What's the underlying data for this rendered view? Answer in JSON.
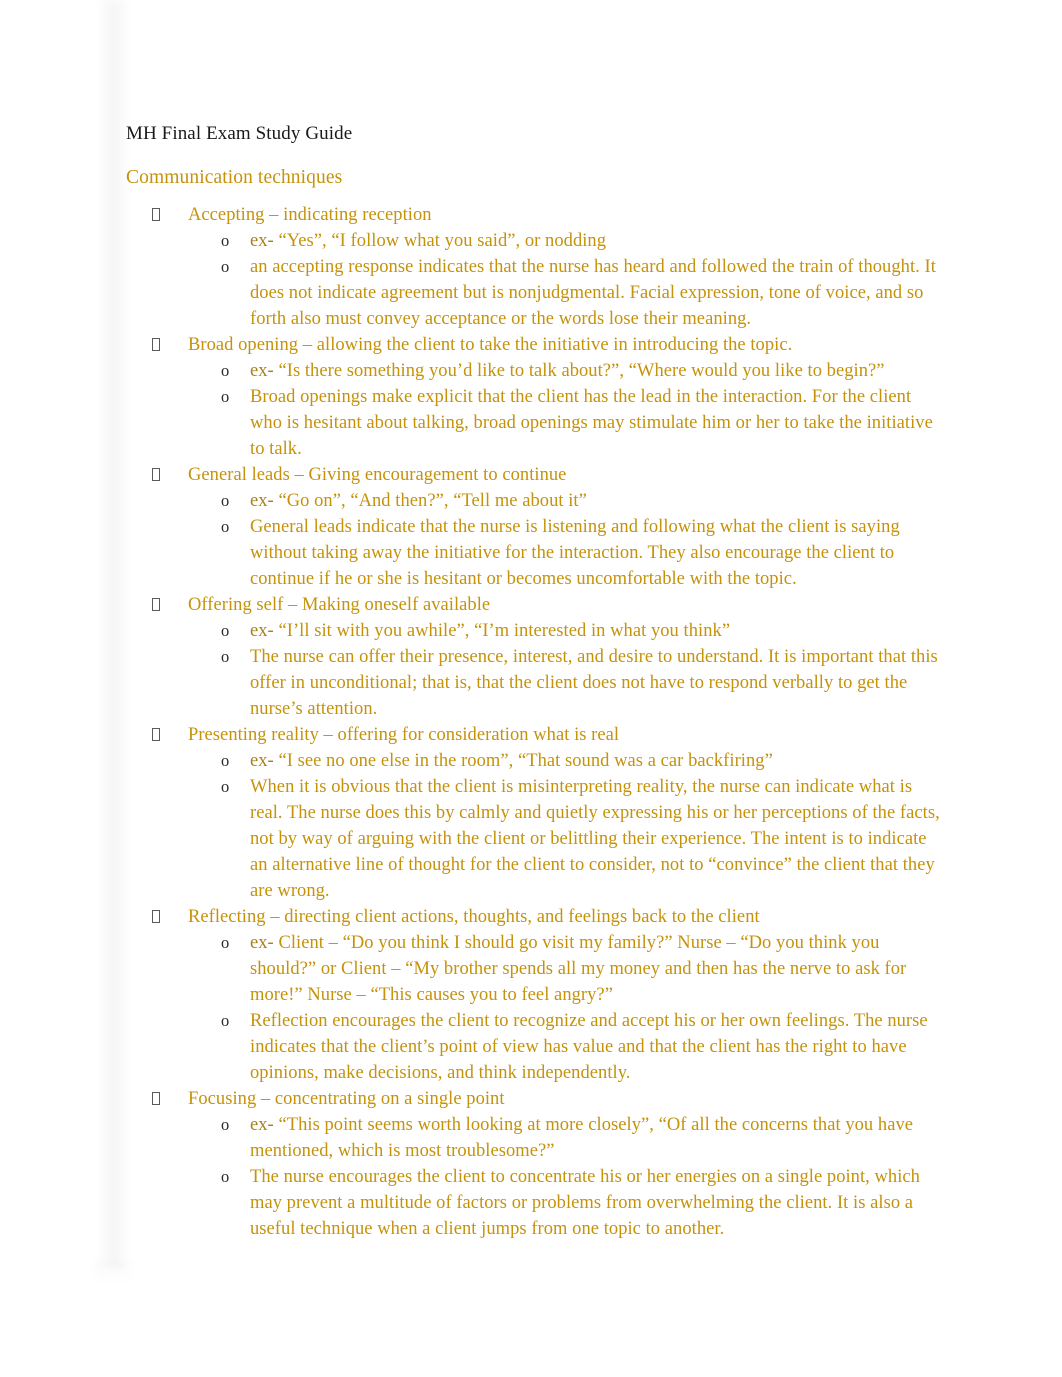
{
  "document": {
    "title": "MH Final Exam Study Guide",
    "section_heading": "Communication techniques",
    "colors": {
      "title_text": "#1a1a1a",
      "body_text": "#c59209",
      "marker_text": "#2b2b2b",
      "page_background": "#ffffff"
    },
    "markers": {
      "level1_glyph": "tofu-box",
      "level2_glyph": "o",
      "example_prefix": "ex-"
    },
    "techniques": [
      {
        "heading": "Accepting – indicating reception",
        "example_prefix": "ex-",
        "example": "“Yes”, “I follow what you said”, or nodding",
        "description": "an accepting response indicates that the nurse has heard and followed the train of thought. It does not indicate agreement but is nonjudgmental. Facial expression, tone of voice, and so forth also must convey acceptance or the words lose their meaning."
      },
      {
        "heading": "Broad opening – allowing the client to take the initiative in introducing the topic.",
        "example_prefix": "ex-",
        "example": "“Is there something you’d like to talk about?”, “Where would you like to begin?”",
        "description": "Broad openings make explicit that the client has the lead in the interaction. For the client who is hesitant about talking, broad openings may stimulate him or her to take the initiative to talk."
      },
      {
        "heading": "General leads – Giving encouragement to continue",
        "example_prefix": "ex-",
        "example": "“Go on”, “And then?”, “Tell me about it”",
        "description": "General leads indicate that the nurse is listening and following what the client is saying without taking away the initiative for the interaction. They also encourage the client to continue if he or she is hesitant or becomes uncomfortable with the topic."
      },
      {
        "heading": "Offering self – Making oneself available",
        "example_prefix": "ex-",
        "example": "“I’ll sit with you awhile”, “I’m interested in what you think”",
        "description": "The nurse can offer their presence, interest, and desire to understand. It is important that this offer in unconditional; that is, that the client does not have to respond verbally to get the nurse’s attention."
      },
      {
        "heading": "Presenting reality – offering for consideration what is real",
        "example_prefix": "ex-",
        "example": "“I see no one else in the room”, “That sound was a car backfiring”",
        "description": "When it is obvious that the client is misinterpreting reality, the nurse can indicate what is real. The nurse does this by calmly and quietly expressing his or her perceptions of the facts, not by way of arguing with the client or belittling their experience. The intent is to indicate an alternative line of thought for the client to consider, not to “convince” the client that they are wrong."
      },
      {
        "heading": "Reflecting – directing client actions, thoughts, and feelings back to the client",
        "example_prefix": "ex-",
        "example": "Client – “Do you think I should go visit my family?” Nurse – “Do you think you should?” or Client – “My brother spends all my money and then has the nerve to ask for more!” Nurse – “This causes you to feel angry?”",
        "description": "Reflection encourages the client to recognize and accept his or her own feelings. The nurse indicates that the client’s point of view has value and that the client has the right to have opinions, make decisions, and think independently."
      },
      {
        "heading": "Focusing – concentrating on a single point",
        "example_prefix": "ex-",
        "example": "“This point seems worth looking at more closely”, “Of all the concerns that you have mentioned, which is most troublesome?”",
        "description": "The nurse encourages the client to concentrate his or her energies on a single point, which may prevent a multitude of factors or problems from overwhelming the client. It is also a useful technique when a client jumps from one topic to another."
      }
    ]
  }
}
